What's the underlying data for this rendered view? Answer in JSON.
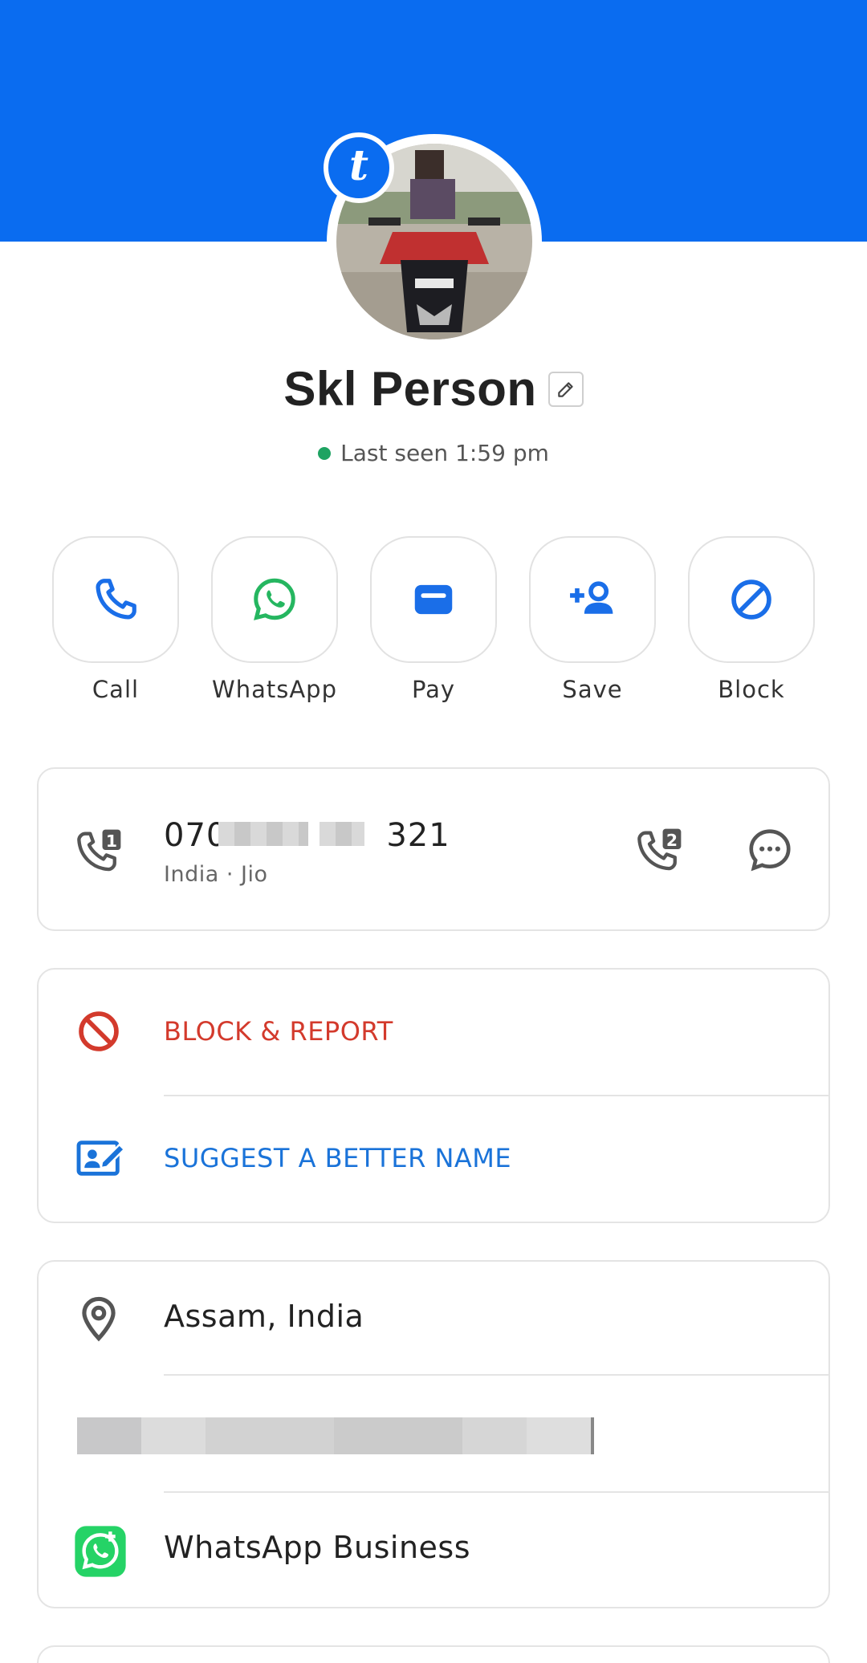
{
  "contact": {
    "name": "Skl Person",
    "status": "Last seen 1:59 pm",
    "badge_letter": "t"
  },
  "actions": [
    {
      "label": "Call",
      "icon": "phone-icon"
    },
    {
      "label": "WhatsApp",
      "icon": "whatsapp-icon"
    },
    {
      "label": "Pay",
      "icon": "wallet-icon"
    },
    {
      "label": "Save",
      "icon": "add-person-icon"
    },
    {
      "label": "Block",
      "icon": "block-icon"
    }
  ],
  "number": {
    "prefix": "070",
    "suffix": "321",
    "subtitle": "India · Jio"
  },
  "options": {
    "block_report": "BLOCK & REPORT",
    "suggest_name": "SUGGEST A BETTER NAME"
  },
  "info": {
    "location": "Assam, India",
    "business": "WhatsApp Business"
  },
  "colors": {
    "brand_blue": "#0a6cf0",
    "danger_red": "#d33a2c",
    "link_blue": "#1a73d9",
    "online_green": "#1ea362",
    "whatsapp_green": "#25d366"
  }
}
